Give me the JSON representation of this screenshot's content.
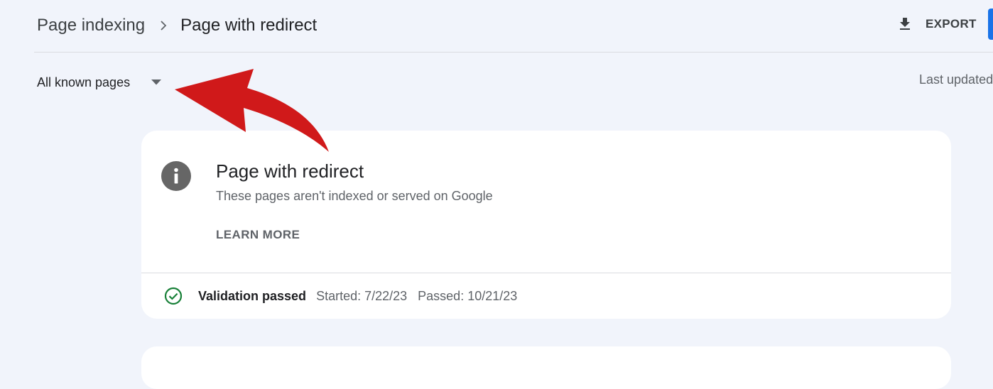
{
  "header": {
    "breadcrumb_parent": "Page indexing",
    "breadcrumb_current": "Page with redirect",
    "export_label": "EXPORT"
  },
  "filter": {
    "scope_label": "All known pages",
    "last_updated": "Last updated"
  },
  "issue_card": {
    "title": "Page with redirect",
    "subtitle": "These pages aren't indexed or served on Google",
    "learn_more": "LEARN MORE",
    "validation": {
      "status": "Validation passed",
      "started": "Started: 7/22/23",
      "passed": "Passed: 10/21/23"
    }
  },
  "icons": {
    "breadcrumb_separator": "chevron-right-icon",
    "export": "download-icon",
    "scope_caret": "caret-down-icon",
    "info": "info-icon",
    "validation": "check-circle-icon"
  },
  "colors": {
    "page_background": "#f1f4fb",
    "card_background": "#ffffff",
    "info_icon": "#666666",
    "success_green": "#188038",
    "primary_blue": "#1a73e8",
    "annotation_red": "#d0191a"
  }
}
